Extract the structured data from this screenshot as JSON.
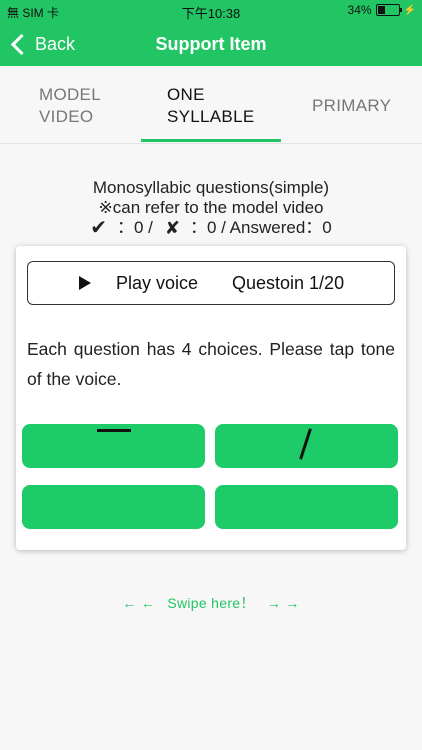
{
  "status_bar": {
    "carrier": "無 SIM 卡",
    "time": "下午10:38",
    "battery_percent": "34%",
    "battery_level": 0.34
  },
  "nav": {
    "back_label": "Back",
    "title": "Support Item"
  },
  "tabs": [
    {
      "line1": "MODEL",
      "line2": "VIDEO",
      "active": false
    },
    {
      "line1": "ONE",
      "line2": "SYLLABLE",
      "active": true
    },
    {
      "line1": "PRIMARY",
      "line2": "",
      "active": false
    }
  ],
  "info": {
    "line1": "Monosyllabic questions(simple)",
    "line2": "※can refer to the model video",
    "correct_icon": "✔",
    "correct_text": "：0 /",
    "wrong_icon": "✘",
    "wrong_text": "：0 / Answered：0"
  },
  "card": {
    "play_label": "Play voice",
    "question_label": "Questoin 1/20",
    "instruction": "Each question has 4 choices. Please tap tone of the voice."
  },
  "choices": [
    {
      "icon": "tone-flat-icon"
    },
    {
      "icon": "tone-rising-icon"
    },
    {
      "icon": "blank"
    },
    {
      "icon": "blank"
    }
  ],
  "swipe": {
    "left_arrows": "←   ←",
    "label": "Swipe here！",
    "right_arrows": "→ →"
  },
  "colors": {
    "accent": "#22c563",
    "button": "#1ecb69"
  }
}
